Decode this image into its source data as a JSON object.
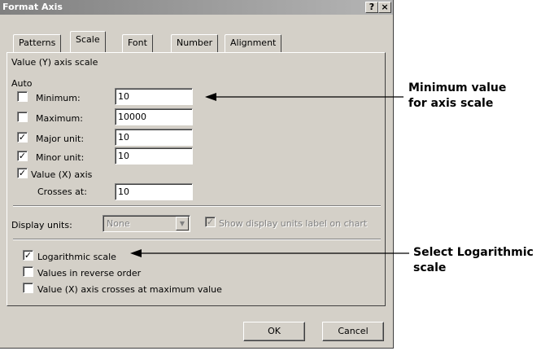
{
  "window": {
    "title": "Format Axis",
    "help_label": "?",
    "close_label": "×"
  },
  "tabs": [
    {
      "label": "Patterns",
      "active": false
    },
    {
      "label": "Scale",
      "active": true
    },
    {
      "label": "Font",
      "active": false
    },
    {
      "label": "Number",
      "active": false
    },
    {
      "label": "Alignment",
      "active": false
    }
  ],
  "scale": {
    "heading": "Value (Y) axis scale",
    "auto_label": "Auto",
    "minimum": {
      "label": "Minimum:",
      "value": "10",
      "auto": false
    },
    "maximum": {
      "label": "Maximum:",
      "value": "10000",
      "auto": false
    },
    "major_unit": {
      "label": "Major unit:",
      "value": "10",
      "auto": true
    },
    "minor_unit": {
      "label": "Minor unit:",
      "value": "10",
      "auto": true
    },
    "crosses": {
      "label": "Value (X) axis",
      "auto": true,
      "sub_label": "Crosses at:",
      "value": "10"
    }
  },
  "display_units": {
    "label": "Display units:",
    "value": "None",
    "show_label_checkbox": "Show display units label on chart",
    "show_label_checked": true
  },
  "options": {
    "logarithmic": {
      "label": "Logarithmic scale",
      "checked": true
    },
    "reverse": {
      "label": "Values in reverse order",
      "checked": false
    },
    "crosses_max": {
      "label": "Value (X) axis crosses at maximum value",
      "checked": false
    }
  },
  "buttons": {
    "ok": "OK",
    "cancel": "Cancel"
  },
  "annotations": {
    "minimum_value": [
      "Minimum value",
      "for axis scale"
    ],
    "logarithmic": [
      "Select Logarithmic",
      "scale"
    ]
  },
  "glyphs": {
    "check": "✓",
    "dropdown_arrow": "▼"
  },
  "colors": {
    "dialog_face": "#d4d0c8",
    "titlebar_inactive": "#808080",
    "arrow": "#000000"
  }
}
